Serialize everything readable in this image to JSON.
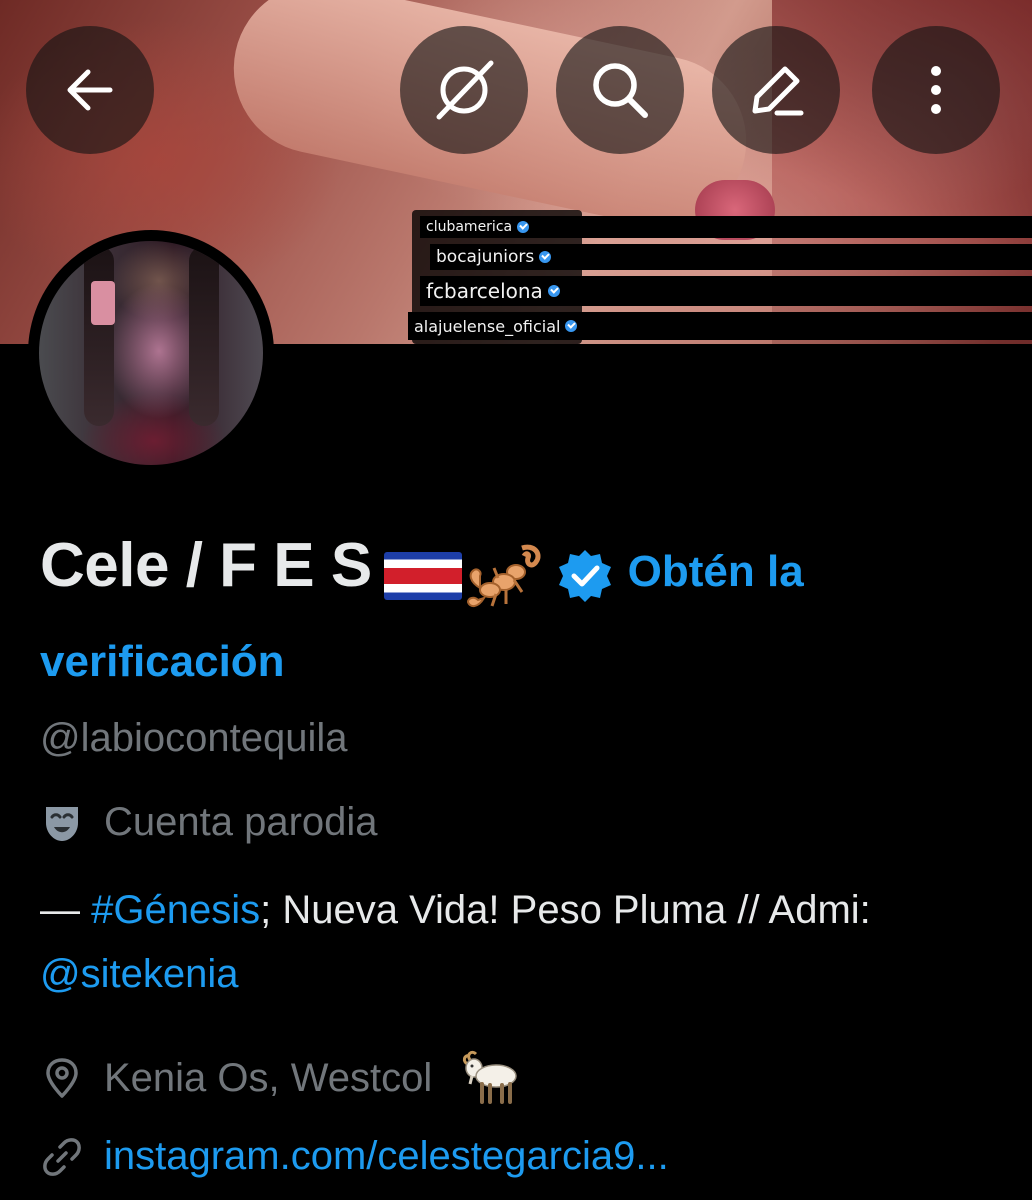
{
  "banner": {
    "tags": [
      "clubamerica",
      "bocajuniors",
      "fcbarcelona",
      "alajuelense_oficial"
    ]
  },
  "nav": {
    "back_icon": "arrow-left-icon",
    "grok_icon": "grok-icon",
    "search_icon": "search-icon",
    "edit_icon": "edit-icon",
    "more_icon": "more-vertical-icon"
  },
  "profile": {
    "display_name": "Cele / F E S",
    "emojis": [
      "costa-rica-flag",
      "scorpion"
    ],
    "verified_badge_color": "#1d9bf0",
    "verify_link": "Obtén la verificación",
    "handle": "@labiocontequila",
    "parody_label": "Cuenta parodia",
    "bio": {
      "prefix": "— ",
      "hashtag": "#Génesis",
      "middle": "; Nueva Vida! Peso Pluma // Admi: ",
      "mention": "@sitekenia"
    },
    "location": "Kenia Os, Westcol",
    "website": "instagram.com/celestegarcia9..."
  },
  "colors": {
    "background": "#000000",
    "text_primary": "#e7e9ea",
    "text_secondary": "#71767b",
    "accent": "#1d9bf0"
  }
}
